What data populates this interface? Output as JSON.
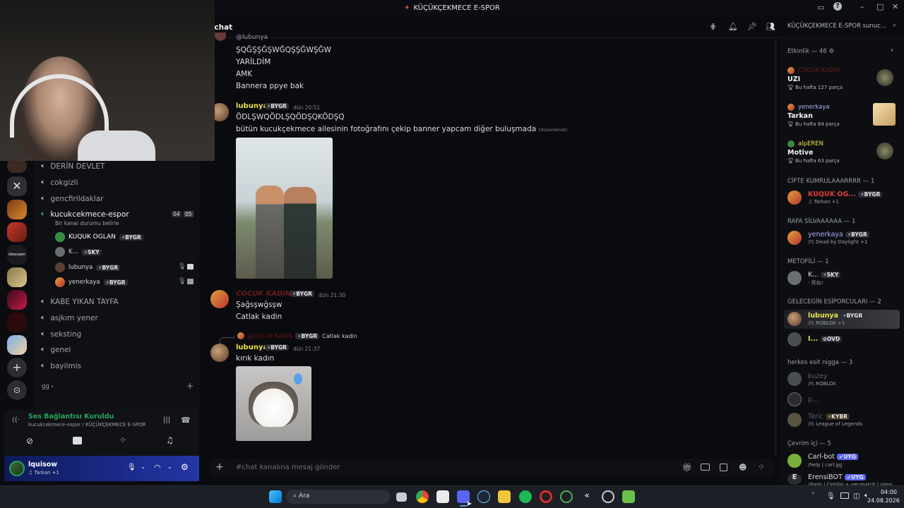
{
  "title_bar": {
    "title": "KÜÇÜKÇEKMECE E-SPOR"
  },
  "channel_header": {
    "name": "chat",
    "search_placeholder": "KÜÇÜKÇEKMECE E-SPOR sunuc..."
  },
  "channels": [
    {
      "name": "DERİN DEVLET"
    },
    {
      "name": "cokgizli"
    },
    {
      "name": "gencfirildaklar"
    },
    {
      "name": "kucukcekmece-espor",
      "count_a": "04",
      "count_b": "05",
      "status": "Bir kanal durumu belirle"
    },
    {
      "name": "KABE YIKAN TAYFA"
    },
    {
      "name": "asjkım yener"
    },
    {
      "name": "seksting"
    },
    {
      "name": "genel"
    },
    {
      "name": "bayilmis"
    }
  ],
  "category": "gg",
  "voice_users": [
    {
      "name": "KUQUK OGLAN",
      "tag": "BYGR"
    },
    {
      "name": "K...",
      "tag": "SKY"
    },
    {
      "name": "lubunya",
      "tag": "BYGR"
    },
    {
      "name": "yenerkaya",
      "tag": "BYGR"
    }
  ],
  "voice_panel": {
    "status": "Ses Bağlantısı Kuruldu",
    "location": "kucukcekmece-espor / KÜÇÜKÇEKMECE E-SPOR"
  },
  "user_panel": {
    "name": "lquisow",
    "activity": "Tarkan +1"
  },
  "messages": {
    "top_user": "@lubunya",
    "top_lines": [
      "ŞQĞŞŞĞŞWĞQŞŞĞWŞĞW",
      "YARİLDİM",
      "AMK",
      "Bannera ppye bak"
    ],
    "m1": {
      "user": "lubunya",
      "tag": "BYGR",
      "time": "dün 20:51",
      "line1": "ÖDLŞWQÖDLŞQÖDŞQKÖDŞQ",
      "line2": "bütün kucukçekmece ailesinin fotoğrafını çekip banner yapcam diğer buluşmada",
      "edited": "(düzenlendi)"
    },
    "m2": {
      "user": "COCUK KADIN",
      "tag": "BYGR",
      "time": "dün 21:30",
      "line1": "Şağsşwğsşw",
      "line2": "Catlak kadin"
    },
    "m3": {
      "reply_user": "@COCUK KADIN",
      "reply_tag": "BYGR",
      "reply_text": "Catlak kadin",
      "user": "lubunya",
      "tag": "BYGR",
      "time": "dün 21:37",
      "line1": "kırık kadın"
    }
  },
  "input": {
    "placeholder": "#chat kanalına mesaj gönder"
  },
  "members": {
    "activity_header": "Etkinlik — 46",
    "activity": [
      {
        "name": "COCUK KADIN",
        "game": "UZI",
        "sub": "Bu hafta 127 parça"
      },
      {
        "name": "yenerkaya",
        "game": "Tarkan",
        "sub": "Bu hafta 84 parça"
      },
      {
        "name": "alpEREN",
        "game": "Motive",
        "sub": "Bu hafta 63 parça"
      }
    ],
    "groups": [
      {
        "header": "CİFTE KUMRULAAARRRR — 1",
        "members": [
          {
            "name": "KUQUK OG...",
            "tag": "BYGR",
            "sub": "Tarkan +1"
          }
        ]
      },
      {
        "header": "RAFA SİLVAAAAAA — 1",
        "members": [
          {
            "name": "yenerkaya",
            "tag": "BYGR",
            "sub": "Dead by Daylight +1"
          }
        ]
      },
      {
        "header": "METOFİLİ — 1",
        "members": [
          {
            "name": "K...",
            "tag": "SKY",
            "sub": "- 死ね!"
          }
        ]
      },
      {
        "header": "GELECEGİN ESİPORCULARI — 2",
        "members": [
          {
            "name": "lubunya",
            "tag": "BYGR",
            "sub": "ROBLOX +1"
          },
          {
            "name": "I...",
            "tag": "OVD",
            "sub": ""
          }
        ]
      },
      {
        "header": "herkes esit nigga — 3",
        "members": [
          {
            "name": "kuzey",
            "tag": "",
            "sub": "ROBLOX"
          },
          {
            "name": "p...",
            "tag": "",
            "sub": ""
          },
          {
            "name": "Taric",
            "tag": "KYBR",
            "sub": "League of Legends"
          }
        ]
      },
      {
        "header": "Çevrim içi — 5",
        "members": [
          {
            "name": "Carl-bot",
            "tag": "UYG",
            "sub": "/help | carl.gg"
          },
          {
            "name": "ErensiBOT",
            "tag": "UYG",
            "sub": "//help | Cehilin + gecmatch | siren"
          }
        ]
      }
    ]
  },
  "taskbar": {
    "search": "Ara",
    "time": "04:00",
    "date": "24.08.2026"
  },
  "colors": {
    "accent": "#5865f2",
    "lubunya": "#e8e24a",
    "mod_red": "#e23c3c",
    "green": "#23a55a"
  }
}
